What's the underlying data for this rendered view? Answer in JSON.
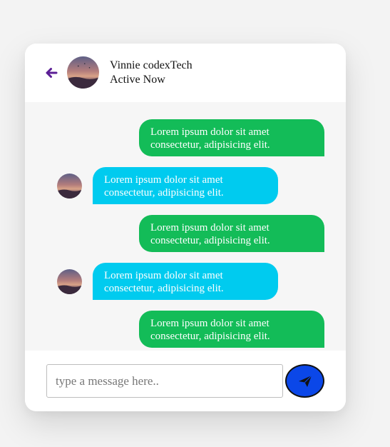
{
  "header": {
    "contact_name": "Vinnie codexTech",
    "status": "Active Now",
    "back_icon": "arrow-left-icon",
    "accent_color": "#5b1e95"
  },
  "messages": [
    {
      "direction": "outgoing",
      "line1": "Lorem ipsum dolor sit amet",
      "line2": "consectetur, adipisicing elit."
    },
    {
      "direction": "incoming",
      "line1": "Lorem ipsum dolor sit amet",
      "line2": "consectetur, adipisicing elit."
    },
    {
      "direction": "outgoing",
      "line1": "Lorem ipsum dolor sit amet",
      "line2": "consectetur, adipisicing elit."
    },
    {
      "direction": "incoming",
      "line1": "Lorem ipsum dolor sit amet",
      "line2": "consectetur, adipisicing elit."
    },
    {
      "direction": "outgoing",
      "line1": "Lorem ipsum dolor sit amet",
      "line2": "consectetur, adipisicing elit."
    }
  ],
  "composer": {
    "placeholder": "type a message here..",
    "value": "",
    "send_icon": "paper-plane-icon"
  },
  "colors": {
    "outgoing_bubble": "#13bc58",
    "incoming_bubble": "#00cbef",
    "send_button": "#0b47e8"
  }
}
